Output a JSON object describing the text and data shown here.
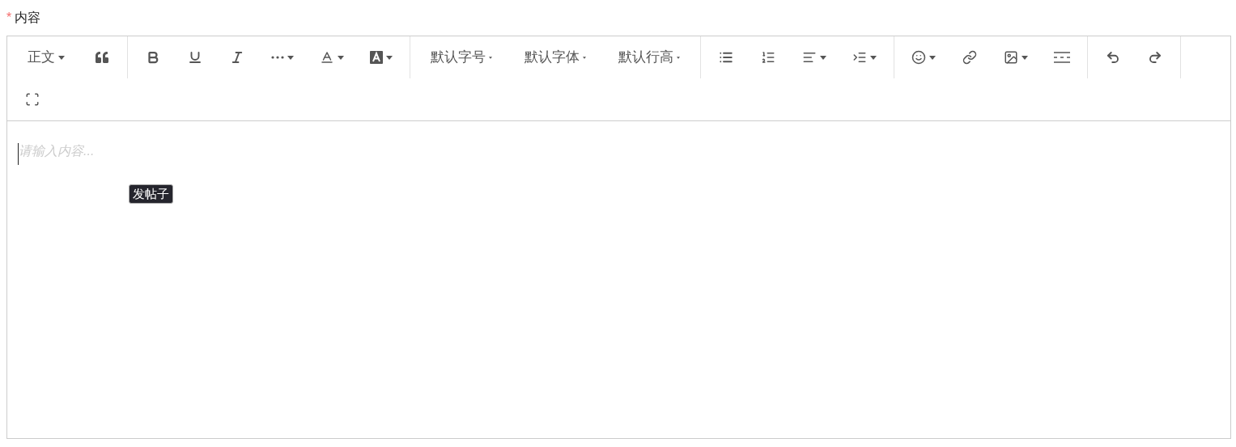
{
  "field": {
    "required_mark": "*",
    "label": "内容"
  },
  "toolbar": [
    {
      "items": [
        {
          "kind": "text",
          "label": "正文",
          "dropdown": true
        },
        {
          "kind": "quote",
          "dropdown": false
        }
      ]
    },
    {
      "items": [
        {
          "kind": "bold",
          "dropdown": false
        },
        {
          "kind": "underline",
          "dropdown": false
        },
        {
          "kind": "italic",
          "dropdown": false
        },
        {
          "kind": "more",
          "dropdown": true
        },
        {
          "kind": "font-color",
          "dropdown": true
        },
        {
          "kind": "back-color",
          "dropdown": true
        }
      ]
    },
    {
      "items": [
        {
          "kind": "text",
          "label": "默认字号",
          "dropdown": true
        },
        {
          "kind": "text",
          "label": "默认字体",
          "dropdown": true
        },
        {
          "kind": "text",
          "label": "默认行高",
          "dropdown": true
        }
      ]
    },
    {
      "items": [
        {
          "kind": "bullet-list",
          "dropdown": false
        },
        {
          "kind": "number-list",
          "dropdown": false
        },
        {
          "kind": "align",
          "dropdown": true
        },
        {
          "kind": "indent",
          "dropdown": true
        }
      ]
    },
    {
      "items": [
        {
          "kind": "emoji",
          "dropdown": true
        },
        {
          "kind": "link",
          "dropdown": false
        },
        {
          "kind": "image",
          "dropdown": true
        },
        {
          "kind": "divider",
          "dropdown": false
        }
      ]
    },
    {
      "items": [
        {
          "kind": "undo",
          "dropdown": false
        },
        {
          "kind": "redo",
          "dropdown": false
        }
      ]
    },
    {
      "items": [
        {
          "kind": "fullscreen",
          "dropdown": false
        }
      ]
    }
  ],
  "editor": {
    "placeholder": "请输入内容...",
    "tooltip": "发帖子"
  }
}
